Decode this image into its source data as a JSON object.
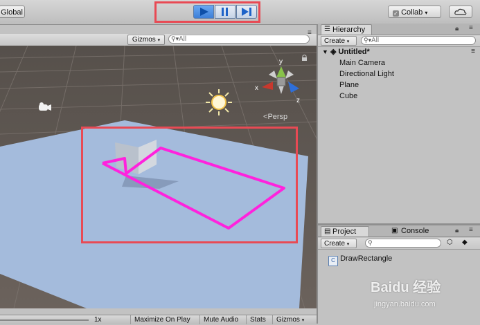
{
  "toolbar": {
    "global_label": "Global",
    "collab_label": "Collab",
    "play_icon": "play-icon",
    "pause_icon": "pause-icon",
    "step_icon": "step-icon"
  },
  "scene": {
    "gizmos_label": "Gizmos",
    "search_placeholder": "All",
    "persp_label": "Persp",
    "axis_x": "x",
    "axis_y": "y",
    "axis_z": "z"
  },
  "footer": {
    "scale_label": "1x",
    "maximize": "Maximize On Play",
    "mute": "Mute Audio",
    "stats": "Stats",
    "gizmos": "Gizmos"
  },
  "hierarchy": {
    "tab_label": "Hierarchy",
    "create_label": "Create",
    "search_placeholder": "All",
    "scene_name": "Untitled*",
    "items": [
      "Main Camera",
      "Directional Light",
      "Plane",
      "Cube"
    ]
  },
  "project": {
    "tab_label": "Project",
    "console_tab_label": "Console",
    "create_label": "Create",
    "asset": "DrawRectangle"
  },
  "watermark": {
    "brand": "Baidu 经验",
    "url": "jingyan.baidu.com"
  },
  "colors": {
    "highlight_box": "#e84a54",
    "magenta_rect": "#ff22dd",
    "plane": "#a4bbdc",
    "play_active": "#3d8ff0"
  }
}
